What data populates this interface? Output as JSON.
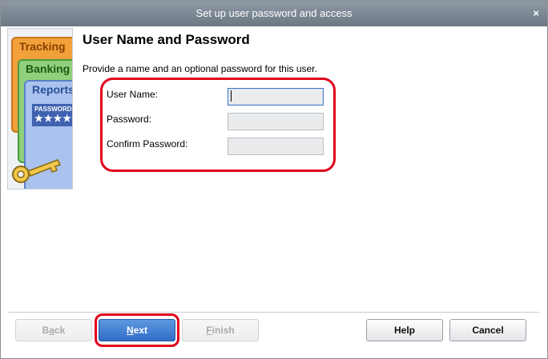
{
  "window": {
    "title": "Set up user password and access",
    "close_glyph": "×"
  },
  "illustration": {
    "cards": [
      "Tracking",
      "Banking",
      "Reports"
    ],
    "password_strip_text": "PASSWORD",
    "password_stars": "★★★★",
    "icon": "key-icon"
  },
  "page": {
    "heading": "User Name and Password",
    "instruction": "Provide a name and an optional password for this user."
  },
  "form": {
    "user_name_label": "User Name:",
    "user_name_value": "",
    "password_label": "Password:",
    "password_value": "",
    "confirm_password_label": "Confirm Password:",
    "confirm_password_value": ""
  },
  "buttons": {
    "back": {
      "label": "Back",
      "mnemonic": "a",
      "enabled": false
    },
    "next": {
      "label": "Next",
      "mnemonic": "N",
      "enabled": true
    },
    "finish": {
      "label": "Finish",
      "mnemonic": "F",
      "enabled": false
    },
    "help": {
      "label": "Help",
      "enabled": true
    },
    "cancel": {
      "label": "Cancel",
      "enabled": true
    }
  },
  "colors": {
    "annotation_red": "#e0001a",
    "accent_blue": "#2f6ec7"
  }
}
